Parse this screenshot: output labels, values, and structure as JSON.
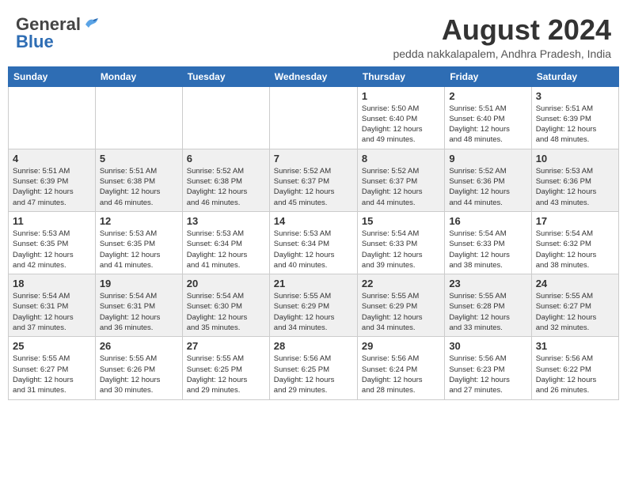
{
  "logo": {
    "general": "General",
    "blue": "Blue"
  },
  "header": {
    "month_year": "August 2024",
    "location": "pedda nakkalapalem, Andhra Pradesh, India"
  },
  "weekdays": [
    "Sunday",
    "Monday",
    "Tuesday",
    "Wednesday",
    "Thursday",
    "Friday",
    "Saturday"
  ],
  "weeks": [
    [
      {
        "day": "",
        "info": ""
      },
      {
        "day": "",
        "info": ""
      },
      {
        "day": "",
        "info": ""
      },
      {
        "day": "",
        "info": ""
      },
      {
        "day": "1",
        "info": "Sunrise: 5:50 AM\nSunset: 6:40 PM\nDaylight: 12 hours\nand 49 minutes."
      },
      {
        "day": "2",
        "info": "Sunrise: 5:51 AM\nSunset: 6:40 PM\nDaylight: 12 hours\nand 48 minutes."
      },
      {
        "day": "3",
        "info": "Sunrise: 5:51 AM\nSunset: 6:39 PM\nDaylight: 12 hours\nand 48 minutes."
      }
    ],
    [
      {
        "day": "4",
        "info": "Sunrise: 5:51 AM\nSunset: 6:39 PM\nDaylight: 12 hours\nand 47 minutes."
      },
      {
        "day": "5",
        "info": "Sunrise: 5:51 AM\nSunset: 6:38 PM\nDaylight: 12 hours\nand 46 minutes."
      },
      {
        "day": "6",
        "info": "Sunrise: 5:52 AM\nSunset: 6:38 PM\nDaylight: 12 hours\nand 46 minutes."
      },
      {
        "day": "7",
        "info": "Sunrise: 5:52 AM\nSunset: 6:37 PM\nDaylight: 12 hours\nand 45 minutes."
      },
      {
        "day": "8",
        "info": "Sunrise: 5:52 AM\nSunset: 6:37 PM\nDaylight: 12 hours\nand 44 minutes."
      },
      {
        "day": "9",
        "info": "Sunrise: 5:52 AM\nSunset: 6:36 PM\nDaylight: 12 hours\nand 44 minutes."
      },
      {
        "day": "10",
        "info": "Sunrise: 5:53 AM\nSunset: 6:36 PM\nDaylight: 12 hours\nand 43 minutes."
      }
    ],
    [
      {
        "day": "11",
        "info": "Sunrise: 5:53 AM\nSunset: 6:35 PM\nDaylight: 12 hours\nand 42 minutes."
      },
      {
        "day": "12",
        "info": "Sunrise: 5:53 AM\nSunset: 6:35 PM\nDaylight: 12 hours\nand 41 minutes."
      },
      {
        "day": "13",
        "info": "Sunrise: 5:53 AM\nSunset: 6:34 PM\nDaylight: 12 hours\nand 41 minutes."
      },
      {
        "day": "14",
        "info": "Sunrise: 5:53 AM\nSunset: 6:34 PM\nDaylight: 12 hours\nand 40 minutes."
      },
      {
        "day": "15",
        "info": "Sunrise: 5:54 AM\nSunset: 6:33 PM\nDaylight: 12 hours\nand 39 minutes."
      },
      {
        "day": "16",
        "info": "Sunrise: 5:54 AM\nSunset: 6:33 PM\nDaylight: 12 hours\nand 38 minutes."
      },
      {
        "day": "17",
        "info": "Sunrise: 5:54 AM\nSunset: 6:32 PM\nDaylight: 12 hours\nand 38 minutes."
      }
    ],
    [
      {
        "day": "18",
        "info": "Sunrise: 5:54 AM\nSunset: 6:31 PM\nDaylight: 12 hours\nand 37 minutes."
      },
      {
        "day": "19",
        "info": "Sunrise: 5:54 AM\nSunset: 6:31 PM\nDaylight: 12 hours\nand 36 minutes."
      },
      {
        "day": "20",
        "info": "Sunrise: 5:54 AM\nSunset: 6:30 PM\nDaylight: 12 hours\nand 35 minutes."
      },
      {
        "day": "21",
        "info": "Sunrise: 5:55 AM\nSunset: 6:29 PM\nDaylight: 12 hours\nand 34 minutes."
      },
      {
        "day": "22",
        "info": "Sunrise: 5:55 AM\nSunset: 6:29 PM\nDaylight: 12 hours\nand 34 minutes."
      },
      {
        "day": "23",
        "info": "Sunrise: 5:55 AM\nSunset: 6:28 PM\nDaylight: 12 hours\nand 33 minutes."
      },
      {
        "day": "24",
        "info": "Sunrise: 5:55 AM\nSunset: 6:27 PM\nDaylight: 12 hours\nand 32 minutes."
      }
    ],
    [
      {
        "day": "25",
        "info": "Sunrise: 5:55 AM\nSunset: 6:27 PM\nDaylight: 12 hours\nand 31 minutes."
      },
      {
        "day": "26",
        "info": "Sunrise: 5:55 AM\nSunset: 6:26 PM\nDaylight: 12 hours\nand 30 minutes."
      },
      {
        "day": "27",
        "info": "Sunrise: 5:55 AM\nSunset: 6:25 PM\nDaylight: 12 hours\nand 29 minutes."
      },
      {
        "day": "28",
        "info": "Sunrise: 5:56 AM\nSunset: 6:25 PM\nDaylight: 12 hours\nand 29 minutes."
      },
      {
        "day": "29",
        "info": "Sunrise: 5:56 AM\nSunset: 6:24 PM\nDaylight: 12 hours\nand 28 minutes."
      },
      {
        "day": "30",
        "info": "Sunrise: 5:56 AM\nSunset: 6:23 PM\nDaylight: 12 hours\nand 27 minutes."
      },
      {
        "day": "31",
        "info": "Sunrise: 5:56 AM\nSunset: 6:22 PM\nDaylight: 12 hours\nand 26 minutes."
      }
    ]
  ]
}
